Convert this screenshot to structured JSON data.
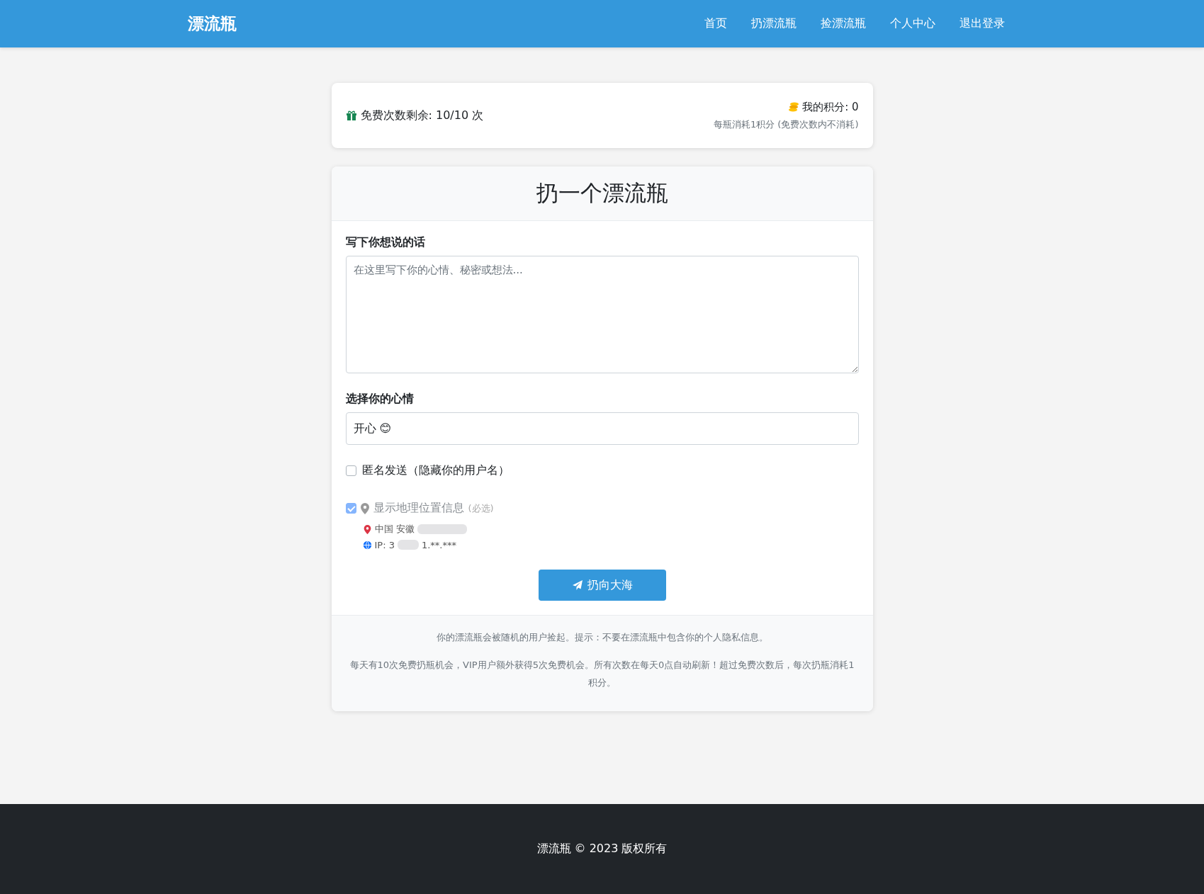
{
  "navbar": {
    "brand": "漂流瓶",
    "links": [
      {
        "label": "首页",
        "selected": false
      },
      {
        "label": "扔漂流瓶",
        "selected": false
      },
      {
        "label": "捡漂流瓶",
        "selected": false
      },
      {
        "label": "个人中心",
        "selected": false
      },
      {
        "label": "退出登录",
        "selected": false
      }
    ]
  },
  "stats": {
    "free_remaining": "免费次数剩余: 10/10 次",
    "points": "我的积分: 0",
    "points_note": "每瓶消耗1积分 (免费次数内不消耗)"
  },
  "form": {
    "title": "扔一个漂流瓶",
    "message_label": "写下你想说的话",
    "message_placeholder": "在这里写下你的心情、秘密或想法...",
    "mood_label": "选择你的心情",
    "mood_value": "开心 😊",
    "anonymous": {
      "label": "匿名发送（隐藏你的用户名）",
      "checked": false
    },
    "location": {
      "label": "显示地理位置信息",
      "hint": "(必选)",
      "checked": true,
      "disabled": true,
      "place": "中国 安徽",
      "ip_start": "IP: 3",
      "ip_end": "1.**.***"
    },
    "submit": "扔向大海"
  },
  "notes": [
    "你的漂流瓶会被随机的用户捡起。提示：不要在漂流瓶中包含你的个人隐私信息。",
    "每天有10次免费扔瓶机会，VIP用户额外获得5次免费机会。所有次数在每天0点自动刷新！超过免费次数后，每次扔瓶消耗1积分。"
  ],
  "footer": "漂流瓶 © 2023 版权所有"
}
